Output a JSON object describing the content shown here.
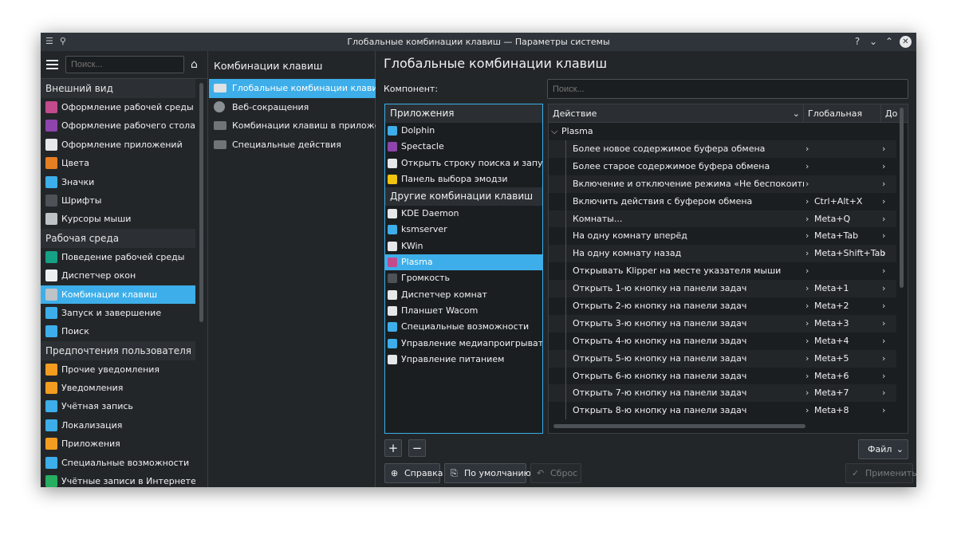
{
  "window": {
    "title": "Глобальные комбинации клавиш — Параметры системы",
    "pin_icon": "pin-icon",
    "help_symbol": "?",
    "minimize_symbol": "⌄",
    "maximize_symbol": "⌃",
    "close_symbol": "✕"
  },
  "sidebar": {
    "search_placeholder": "Поиск...",
    "sections": [
      {
        "header": "Внешний вид",
        "items": [
          {
            "label": "Оформление рабочей среды",
            "icon": "global-theme-icon",
            "color": "#c34a8d"
          },
          {
            "label": "Оформление рабочего стола",
            "icon": "plasma-style-icon",
            "color": "#8e44ad"
          },
          {
            "label": "Оформление приложений",
            "icon": "app-style-icon",
            "color": "#e6e7e8"
          },
          {
            "label": "Цвета",
            "icon": "colors-icon",
            "color": "#e67e22"
          },
          {
            "label": "Значки",
            "icon": "icons-icon",
            "color": "#3daee9"
          },
          {
            "label": "Шрифты",
            "icon": "fonts-icon",
            "color": "#4d5257"
          },
          {
            "label": "Курсоры мыши",
            "icon": "cursor-icon",
            "color": "#bdc3c7"
          }
        ]
      },
      {
        "header": "Рабочая среда",
        "items": [
          {
            "label": "Поведение рабочей среды",
            "icon": "workspace-icon",
            "color": "#16a085"
          },
          {
            "label": "Диспетчер окон",
            "icon": "window-manager-icon",
            "color": "#ecf0f1"
          },
          {
            "label": "Комбинации клавиш",
            "icon": "keyboard-icon",
            "color": "#bdc3c7",
            "active": true
          },
          {
            "label": "Запуск и завершение",
            "icon": "startup-icon",
            "color": "#3daee9"
          },
          {
            "label": "Поиск",
            "icon": "search-icon",
            "color": "#3daee9"
          }
        ]
      },
      {
        "header": "Предпочтения пользователя",
        "items": [
          {
            "label": "Прочие уведомления",
            "icon": "bell-icon",
            "color": "#f39c1f"
          },
          {
            "label": "Уведомления",
            "icon": "bell-icon",
            "color": "#f39c1f"
          },
          {
            "label": "Учётная запись",
            "icon": "user-icon",
            "color": "#3daee9"
          },
          {
            "label": "Локализация",
            "icon": "locale-icon",
            "color": "#3daee9"
          },
          {
            "label": "Приложения",
            "icon": "star-icon",
            "color": "#f39c1f"
          },
          {
            "label": "Специальные возможности",
            "icon": "accessibility-icon",
            "color": "#3daee9"
          },
          {
            "label": "Учётные записи в Интернете",
            "icon": "globe-icon",
            "color": "#27ae60"
          }
        ]
      }
    ]
  },
  "middle": {
    "title": "Комбинации клавиш",
    "items": [
      {
        "label": "Глобальные комбинации клавиш",
        "active": true
      },
      {
        "label": "Веб-сокращения"
      },
      {
        "label": "Комбинации клавиш в приложен..."
      },
      {
        "label": "Специальные действия"
      }
    ]
  },
  "main": {
    "title": "Глобальные комбинации клавиш",
    "component_label": "Компонент:",
    "search_placeholder": "Поиск...",
    "applications_header": "Приложения",
    "applications": [
      {
        "label": "Dolphin",
        "color": "#3daee9"
      },
      {
        "label": "Spectacle",
        "color": "#8e44ad"
      },
      {
        "label": "Открыть строку поиска и запуска...",
        "color": "#e6e7e8"
      },
      {
        "label": "Панель выбора эмодзи",
        "color": "#f1c40f"
      }
    ],
    "other_header": "Другие комбинации клавиш",
    "others": [
      {
        "label": "KDE Daemon",
        "color": "#e6e7e8"
      },
      {
        "label": "ksmserver",
        "color": "#3daee9"
      },
      {
        "label": "KWin",
        "color": "#e6e7e8"
      },
      {
        "label": "Plasma",
        "color": "#c34a8d",
        "active": true
      },
      {
        "label": "Громкость",
        "color": "#4d5257"
      },
      {
        "label": "Диспетчер комнат",
        "color": "#e6e7e8"
      },
      {
        "label": "Планшет Wacom",
        "color": "#e6e7e8"
      },
      {
        "label": "Специальные возможности",
        "color": "#3daee9"
      },
      {
        "label": "Управление медиапроигрывател...",
        "color": "#3daee9"
      },
      {
        "label": "Управление питанием",
        "color": "#e6e7e8"
      }
    ],
    "columns": {
      "action": "Действие",
      "global": "Глобальная",
      "extra": "До"
    },
    "group": "Plasma",
    "rows": [
      {
        "action": "Более новое содержимое буфера обмена",
        "global": ""
      },
      {
        "action": "Более старое содержимое буфера обмена",
        "global": ""
      },
      {
        "action": "Включение и отключение режима «Не беспокоить»",
        "global": ""
      },
      {
        "action": "Включить действия с буфером обмена",
        "global": "Ctrl+Alt+X"
      },
      {
        "action": "Комнаты...",
        "global": "Meta+Q"
      },
      {
        "action": "На одну комнату вперёд",
        "global": "Meta+Tab"
      },
      {
        "action": "На одну комнату назад",
        "global": "Meta+Shift+Tab"
      },
      {
        "action": "Открывать Klipper на месте указателя мыши",
        "global": ""
      },
      {
        "action": "Открыть 1-ю кнопку на панели задач",
        "global": "Meta+1"
      },
      {
        "action": "Открыть 2-ю кнопку на панели задач",
        "global": "Meta+2"
      },
      {
        "action": "Открыть 3-ю кнопку на панели задач",
        "global": "Meta+3"
      },
      {
        "action": "Открыть 4-ю кнопку на панели задач",
        "global": "Meta+4"
      },
      {
        "action": "Открыть 5-ю кнопку на панели задач",
        "global": "Meta+5"
      },
      {
        "action": "Открыть 6-ю кнопку на панели задач",
        "global": "Meta+6"
      },
      {
        "action": "Открыть 7-ю кнопку на панели задач",
        "global": "Meta+7"
      },
      {
        "action": "Открыть 8-ю кнопку на панели задач",
        "global": "Meta+8"
      }
    ],
    "add_symbol": "+",
    "remove_symbol": "−",
    "file_label": "Файл",
    "buttons": {
      "help": "Справка",
      "defaults": "По умолчанию",
      "reset": "Сброс",
      "apply": "Применить"
    }
  },
  "colors": {
    "accent": "#3daee9",
    "background": "#232629",
    "input": "#1b1e20"
  }
}
